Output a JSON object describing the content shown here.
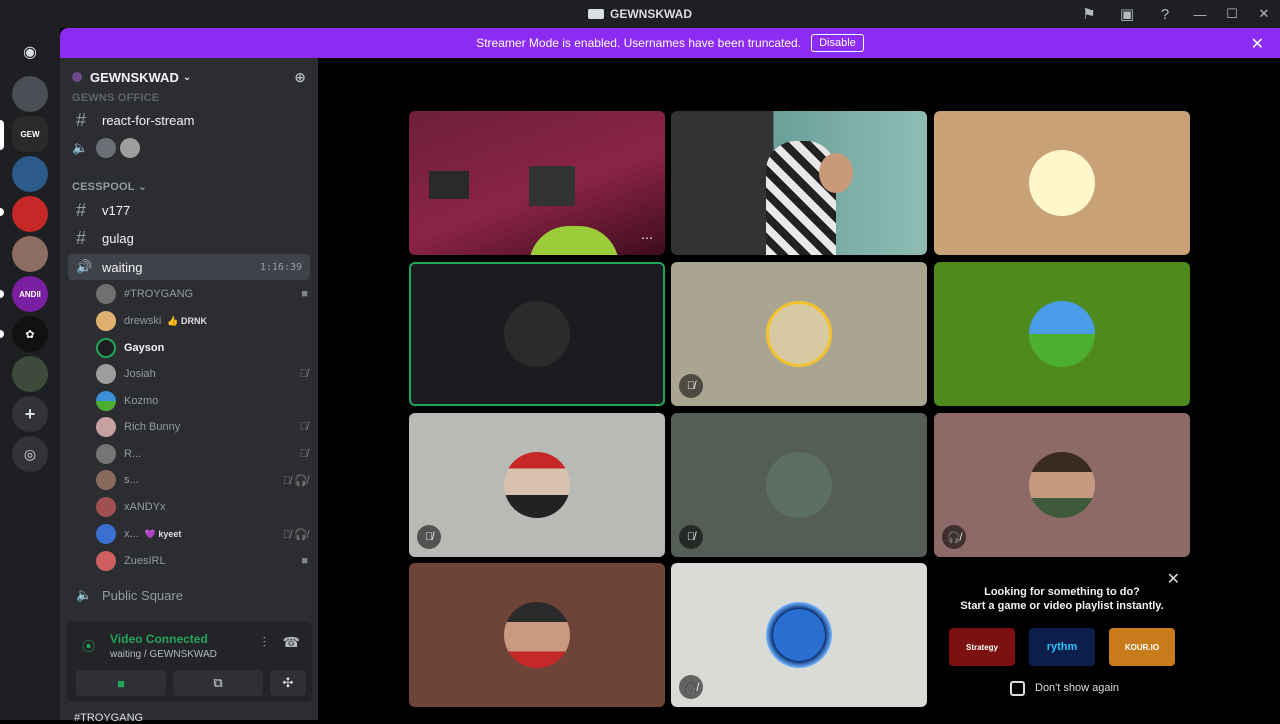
{
  "window": {
    "title": "GEWNSKWAD"
  },
  "banner": {
    "text": "Streamer Mode is enabled. Usernames have been truncated.",
    "button": "Disable"
  },
  "server": {
    "name": "GEWNSKWAD"
  },
  "channels": {
    "top_cut": "GEWNS OFFICE",
    "react": "react-for-stream",
    "category": "CESSPOOL",
    "v177": "v177",
    "gulag": "gulag",
    "waiting": "waiting",
    "waiting_time": "1:16:39",
    "public": "Public Square"
  },
  "voice_users": [
    {
      "name": "#TROYGANG",
      "tag": "",
      "icon": "video-icon"
    },
    {
      "name": "drewski",
      "tag": "👍 DRNK",
      "icon": ""
    },
    {
      "name": "Gayson",
      "tag": "",
      "icon": ""
    },
    {
      "name": "Josiah",
      "tag": "",
      "icon": "mute-icon"
    },
    {
      "name": "Kozmo",
      "tag": "",
      "icon": ""
    },
    {
      "name": "Rich Bunny",
      "tag": "",
      "icon": "mute-icon"
    },
    {
      "name": "R...",
      "tag": "",
      "icon": "mute-icon"
    },
    {
      "name": "s...",
      "tag": "",
      "icon": "deafen-icon"
    },
    {
      "name": "xANDYx",
      "tag": "",
      "icon": ""
    },
    {
      "name": "x...",
      "tag": "💜 kyeet",
      "icon": "deafen-icon"
    },
    {
      "name": "ZuesIRL",
      "tag": "",
      "icon": "video-icon"
    }
  ],
  "connection": {
    "status": "Video Connected",
    "location": "waiting / GEWNSKWAD",
    "bottom_cut": "#TROYGANG"
  },
  "promo": {
    "line1": "Looking for something to do?",
    "line2": "Start a game or video playlist instantly.",
    "games": [
      "Strategy",
      "rythm",
      "KOUR.IO"
    ],
    "checkbox": "Don't show again"
  },
  "colors": {
    "accent": "#8c2cf2",
    "connected": "#23a55a",
    "speaking": "#23a55a"
  }
}
